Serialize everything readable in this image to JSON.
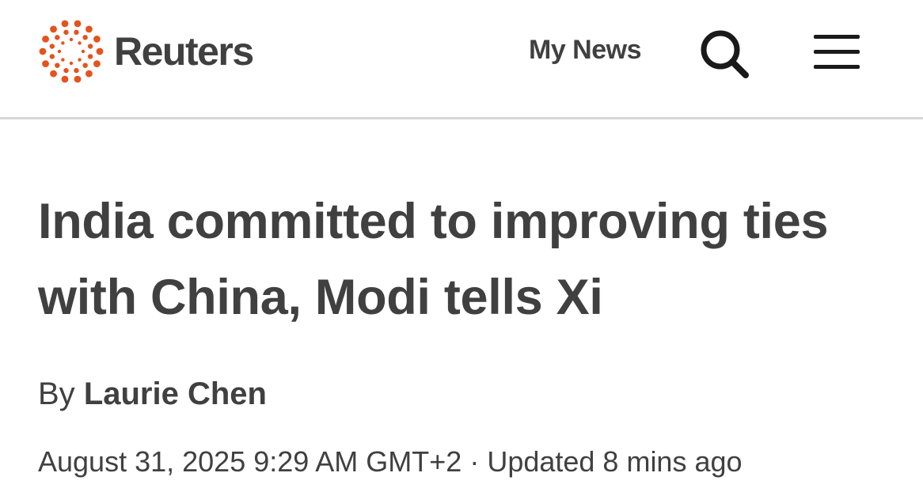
{
  "header": {
    "brand": "Reuters",
    "logo_icon": "reuters-dot-ring-logo",
    "brand_color": "#e5531d",
    "my_news_label": "My News",
    "search_icon": "search-icon",
    "menu_icon": "hamburger-menu-icon"
  },
  "article": {
    "headline": "India committed to improving ties with China, Modi tells Xi",
    "byline_prefix": "By",
    "author": "Laurie Chen",
    "dateline": "August 31, 2025 9:29 AM GMT+2 · Updated 8 mins ago"
  },
  "colors": {
    "text": "#404040",
    "divider": "#d6d6d6",
    "background": "#ffffff"
  }
}
